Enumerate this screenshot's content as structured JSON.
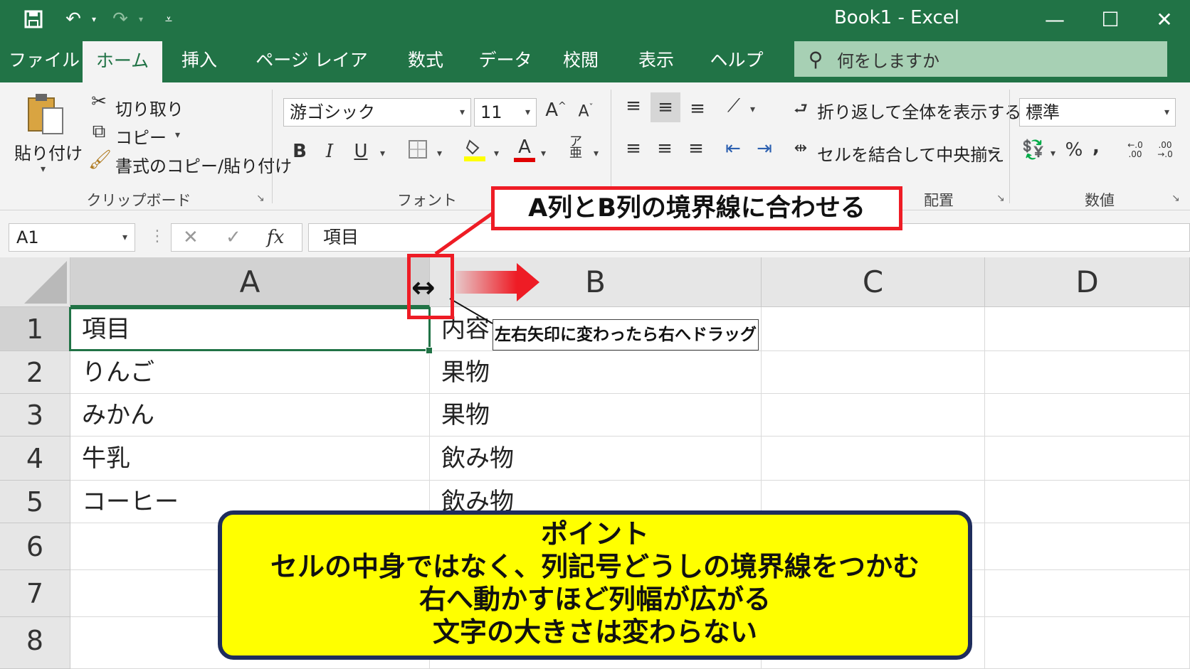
{
  "titlebar": {
    "app_title": "Book1  -  Excel",
    "qat_icons": [
      "save-icon",
      "undo-icon",
      "redo-icon",
      "customize-qat-icon"
    ],
    "window_buttons": {
      "minimize": "—",
      "maximize": "☐",
      "close": "✕"
    }
  },
  "tabs": [
    "ファイル",
    "ホーム",
    "挿入",
    "ページ レイアウト",
    "数式",
    "データ",
    "校閲",
    "表示",
    "ヘルプ"
  ],
  "active_tab": "ホーム",
  "tellme": {
    "placeholder": "何をしますか"
  },
  "ribbon": {
    "clipboard": {
      "paste": "貼り付け",
      "cut": "切り取り",
      "copy": "コピー",
      "format_painter": "書式のコピー/貼り付け",
      "label": "クリップボード"
    },
    "font": {
      "name": "游ゴシック",
      "size": "11",
      "grow": "A",
      "shrink": "A",
      "bold": "B",
      "italic": "I",
      "underline": "U",
      "font_color": "A",
      "label": "フォント"
    },
    "alignment": {
      "wrap": "折り返して全体を表示する",
      "merge": "セルを結合して中央揃え",
      "label": "配置"
    },
    "number": {
      "format": "標準",
      "percent": "%",
      "comma": ",",
      "inc_decimal": "←.0\n.00",
      "dec_decimal": ".00\n→.0",
      "label": "数値"
    }
  },
  "formula_bar": {
    "name_box": "A1",
    "cancel": "✕",
    "enter": "✓",
    "fx": "fx",
    "content": "項目"
  },
  "sheet": {
    "columns": [
      "A",
      "B",
      "C",
      "D"
    ],
    "rows": [
      "1",
      "2",
      "3",
      "4",
      "5",
      "6",
      "7",
      "8"
    ],
    "cells": [
      [
        "項目",
        "内容",
        "",
        ""
      ],
      [
        "りんご",
        "果物",
        "",
        ""
      ],
      [
        "みかん",
        "果物",
        "",
        ""
      ],
      [
        "牛乳",
        "飲み物",
        "",
        ""
      ],
      [
        "コーヒー",
        "飲み物",
        "",
        ""
      ],
      [
        "",
        "",
        "",
        ""
      ],
      [
        "",
        "",
        "",
        ""
      ],
      [
        "",
        "",
        "",
        ""
      ]
    ],
    "selected_cell": "A1"
  },
  "annotations": {
    "callout": "A列とB列の境界線に合わせる",
    "tooltip": "左右矢印に変わったら右へドラッグ",
    "cursor": "↔",
    "point_lines": [
      "ポイント",
      "セルの中身ではなく、列記号どうしの境界線をつかむ",
      "右へ動かすほど列幅が広がる",
      "文字の大きさは変わらない"
    ],
    "accent_red": "#ee1c25",
    "point_bg": "#ffff00",
    "point_border": "#1f2d5c"
  },
  "colors": {
    "excel_green": "#217346",
    "ribbon_bg": "#f3f3f3"
  }
}
